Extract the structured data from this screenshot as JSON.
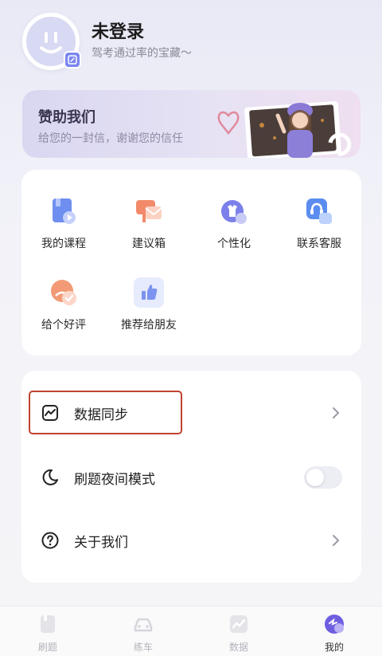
{
  "profile": {
    "name": "未登录",
    "subtitle": "驾考通过率的宝藏～"
  },
  "banner": {
    "title": "赞助我们",
    "subtitle": "给您的一封信，谢谢您的信任"
  },
  "grid": [
    {
      "label": "我的课程",
      "icon": "course-icon"
    },
    {
      "label": "建议箱",
      "icon": "suggestion-box-icon"
    },
    {
      "label": "个性化",
      "icon": "personalize-icon"
    },
    {
      "label": "联系客服",
      "icon": "customer-service-icon"
    },
    {
      "label": "给个好评",
      "icon": "rating-icon"
    },
    {
      "label": "推荐给朋友",
      "icon": "thumbs-up-icon"
    }
  ],
  "list": [
    {
      "label": "数据同步",
      "icon": "chart-sync-icon"
    },
    {
      "label": "刷题夜间模式",
      "icon": "moon-icon",
      "toggle": false
    },
    {
      "label": "关于我们",
      "icon": "question-icon"
    }
  ],
  "tabs": [
    {
      "label": "刷题",
      "icon": "quiz-tab-icon",
      "active": false
    },
    {
      "label": "练车",
      "icon": "car-tab-icon",
      "active": false
    },
    {
      "label": "数据",
      "icon": "chart-tab-icon",
      "active": false
    },
    {
      "label": "我的",
      "icon": "profile-tab-icon",
      "active": true
    }
  ],
  "colors": {
    "accent": "#7c86f0",
    "highlight_border": "#c0432f"
  }
}
